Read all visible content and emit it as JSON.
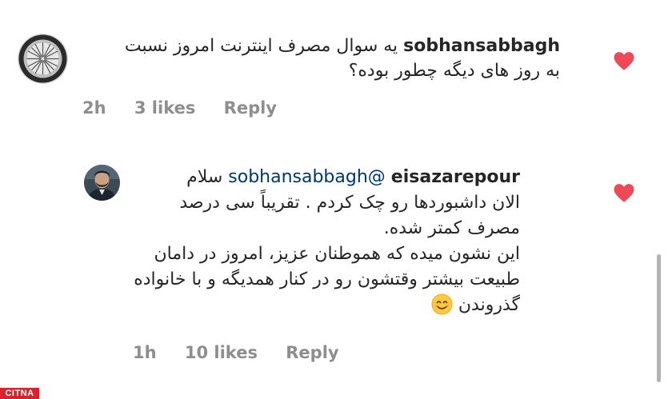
{
  "comments": [
    {
      "username": "sobhansabbagh",
      "text_line1": "یه سوال مصرف اینترنت امروز نسبت",
      "text_line2": "به روز های دیگه چطور بوده؟",
      "time": "2h",
      "likes": "3 likes",
      "reply_label": "Reply",
      "liked": true
    },
    {
      "username": "eisazarepour",
      "mention": "@sobhansabbagh",
      "greeting": "سلام",
      "text_line1": "الان داشبوردها رو چک کردم . تقریباً سی درصد",
      "text_line2": "مصرف کمتر شده.",
      "text_line3": "این نشون میده که هموطنان عزیز، امروز در دامان",
      "text_line4": "طبیعت بیشتر وقتشون رو در کنار همدیگه و با خانواده",
      "text_line5": "گذروندن",
      "emoji": "smiling-face-emoji",
      "time": "1h",
      "likes": "10 likes",
      "reply_label": "Reply",
      "liked": true
    }
  ],
  "watermark": {
    "text": "CITNA",
    "color": "#d8232a"
  },
  "colors": {
    "heart": "#ed4956",
    "meta": "#8e8e8e",
    "mention": "#00376b"
  }
}
